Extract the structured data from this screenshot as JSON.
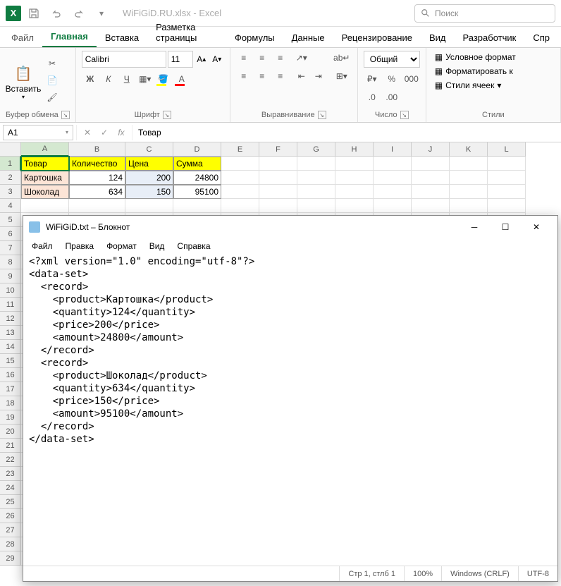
{
  "titlebar": {
    "title": "WiFiGiD.RU.xlsx - Excel",
    "search_placeholder": "Поиск"
  },
  "tabs": {
    "file": "Файл",
    "home": "Главная",
    "insert": "Вставка",
    "pagelayout": "Разметка страницы",
    "formulas": "Формулы",
    "data": "Данные",
    "review": "Рецензирование",
    "view": "Вид",
    "developer": "Разработчик",
    "help": "Спр"
  },
  "ribbon": {
    "clipboard": {
      "paste": "Вставить",
      "label": "Буфер обмена"
    },
    "font": {
      "name": "Calibri",
      "size": "11",
      "label": "Шрифт",
      "bold": "Ж",
      "italic": "К",
      "underline": "Ч"
    },
    "alignment": {
      "label": "Выравнивание",
      "wrap": "ab"
    },
    "number": {
      "format": "Общий",
      "label": "Число"
    },
    "styles": {
      "cond": "Условное формат",
      "table": "Форматировать к",
      "cell": "Стили ячеек",
      "label": "Стили"
    }
  },
  "formula_bar": {
    "namebox": "A1",
    "fx": "fx",
    "value": "Товар"
  },
  "columns": [
    "A",
    "B",
    "C",
    "D",
    "E",
    "F",
    "G",
    "H",
    "I",
    "J",
    "K",
    "L"
  ],
  "headers": [
    "Товар",
    "Количество",
    "Цена",
    "Сумма"
  ],
  "data": [
    [
      "Картошка",
      "124",
      "200",
      "24800"
    ],
    [
      "Шоколад",
      "634",
      "150",
      "95100"
    ]
  ],
  "notepad": {
    "title": "WiFiGiD.txt – Блокнот",
    "menu": [
      "Файл",
      "Правка",
      "Формат",
      "Вид",
      "Справка"
    ],
    "content": "<?xml version=\"1.0\" encoding=\"utf-8\"?>\n<data-set>\n  <record>\n    <product>Картошка</product>\n    <quantity>124</quantity>\n    <price>200</price>\n    <amount>24800</amount>\n  </record>\n  <record>\n    <product>Шоколад</product>\n    <quantity>634</quantity>\n    <price>150</price>\n    <amount>95100</amount>\n  </record>\n</data-set>",
    "status": {
      "pos": "Стр 1, стлб 1",
      "zoom": "100%",
      "eol": "Windows (CRLF)",
      "enc": "UTF-8"
    }
  }
}
